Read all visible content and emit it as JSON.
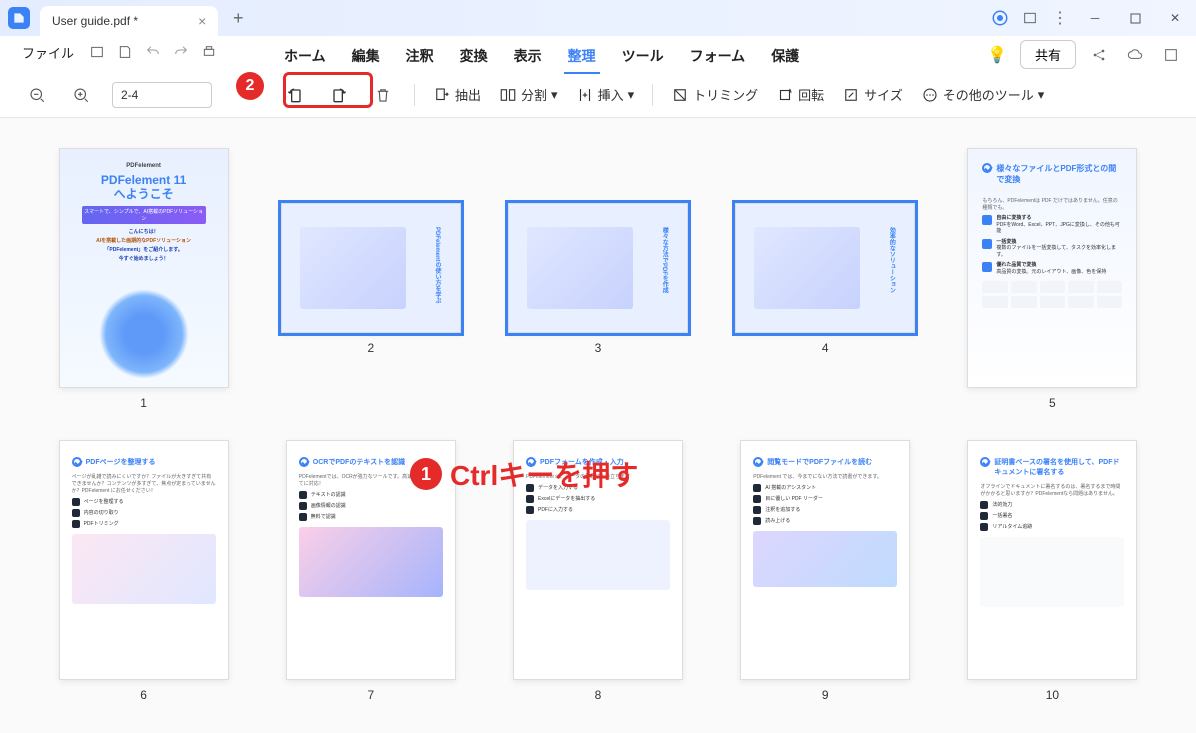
{
  "titlebar": {
    "filename": "User guide.pdf *"
  },
  "menubar": {
    "file": "ファイル"
  },
  "tabs": {
    "home": "ホーム",
    "edit": "編集",
    "annotate": "注釈",
    "convert": "変換",
    "view": "表示",
    "organize": "整理",
    "tool": "ツール",
    "form": "フォーム",
    "protect": "保護"
  },
  "share": "共有",
  "toolbar": {
    "page_input": "2-4",
    "extract": "抽出",
    "split": "分割",
    "insert": "挿入",
    "trim": "トリミング",
    "rotate": "回転",
    "size": "サイズ",
    "more": "その他のツール"
  },
  "annotation": {
    "label1": "Ctrlキーを押す",
    "num1": "1",
    "num2": "2"
  },
  "thumbs": {
    "labels": [
      "1",
      "2",
      "3",
      "4",
      "5",
      "6",
      "7",
      "8",
      "9",
      "10"
    ],
    "p1": {
      "brand": "PDFelement",
      "title1": "PDFelement 11",
      "title2": "へようこそ",
      "bar": "スマートで、シンプルで、AI搭載のPDFソリューション",
      "t1": "こんにちは！",
      "t2": "AIを搭載した画期的なPDFソリューション",
      "t3": "「PDFelement」をご紹介します。",
      "t4": "今すぐ始めましょう！"
    },
    "p2": {
      "h": "PDFelementの使い方を学ぶ"
    },
    "p3": {
      "h": "様々な方法でPDFを作成"
    },
    "p4": {
      "h": "効率的なソリューション"
    },
    "p5": {
      "h": "様々なファイルとPDF形式との間で変換",
      "sub": "もちろん、PDFelementは PDF だけではありません。任意の種類でも。",
      "i1": "自由に変換する",
      "i1s": "PDFをWord、Excel、PPT、JPGに変換し、その他も可能",
      "i2": "一括変換",
      "i2s": "複数のファイルを一括変換して、タスクを効率化します。",
      "i3": "優れた品質で変換",
      "i3s": "高品質の変換。元のレイアウト、画像、色を保持"
    },
    "p6": {
      "h": "PDFページを整理する",
      "sub": "ページが乱雑で読みにくいですか？ファイルが大きすぎて共有できませんか？コンテンツが多すぎて、焦点が定まっていませんか？PDFelement にお任せください！",
      "i1": "ページを整理する",
      "i2": "内容の切り取り",
      "i3": "PDFトリミング"
    },
    "p7": {
      "h": "OCRでPDFのテキストを認識",
      "sub": "PDFelementでは、OCRが強力なツールです。高速、正確、すべてに対応！",
      "i1": "テキストの認識",
      "i2": "画像情報の認識",
      "i3": "無料で認識"
    },
    "p8": {
      "h": "PDFフォームを作成・入力",
      "sub": "PDFelement は、データの整理にも役立ちます",
      "i1": "データを入力する",
      "i2": "Excelにデータを抽出する",
      "i3": "PDFに入力する"
    },
    "p9": {
      "h": "閲覧モードでPDFファイルを読む",
      "sub": "PDFelement では、今までにない方法で読書ができます。",
      "i1": "AI 搭載のアシスタント",
      "i2": "目に優しい PDF リーダー",
      "i3": "注釈を追加する",
      "i4": "読み上げる"
    },
    "p10": {
      "h": "証明書ベースの署名を使用して、PDFドキュメントに署名する",
      "sub": "オフラインでドキュメントに署名するのは、署名するまで時間がかかると思いますか？PDFelementなら問題はありません。",
      "i1": "法的効力",
      "i2": "一括署名",
      "i3": "リアルタイム追跡"
    }
  }
}
